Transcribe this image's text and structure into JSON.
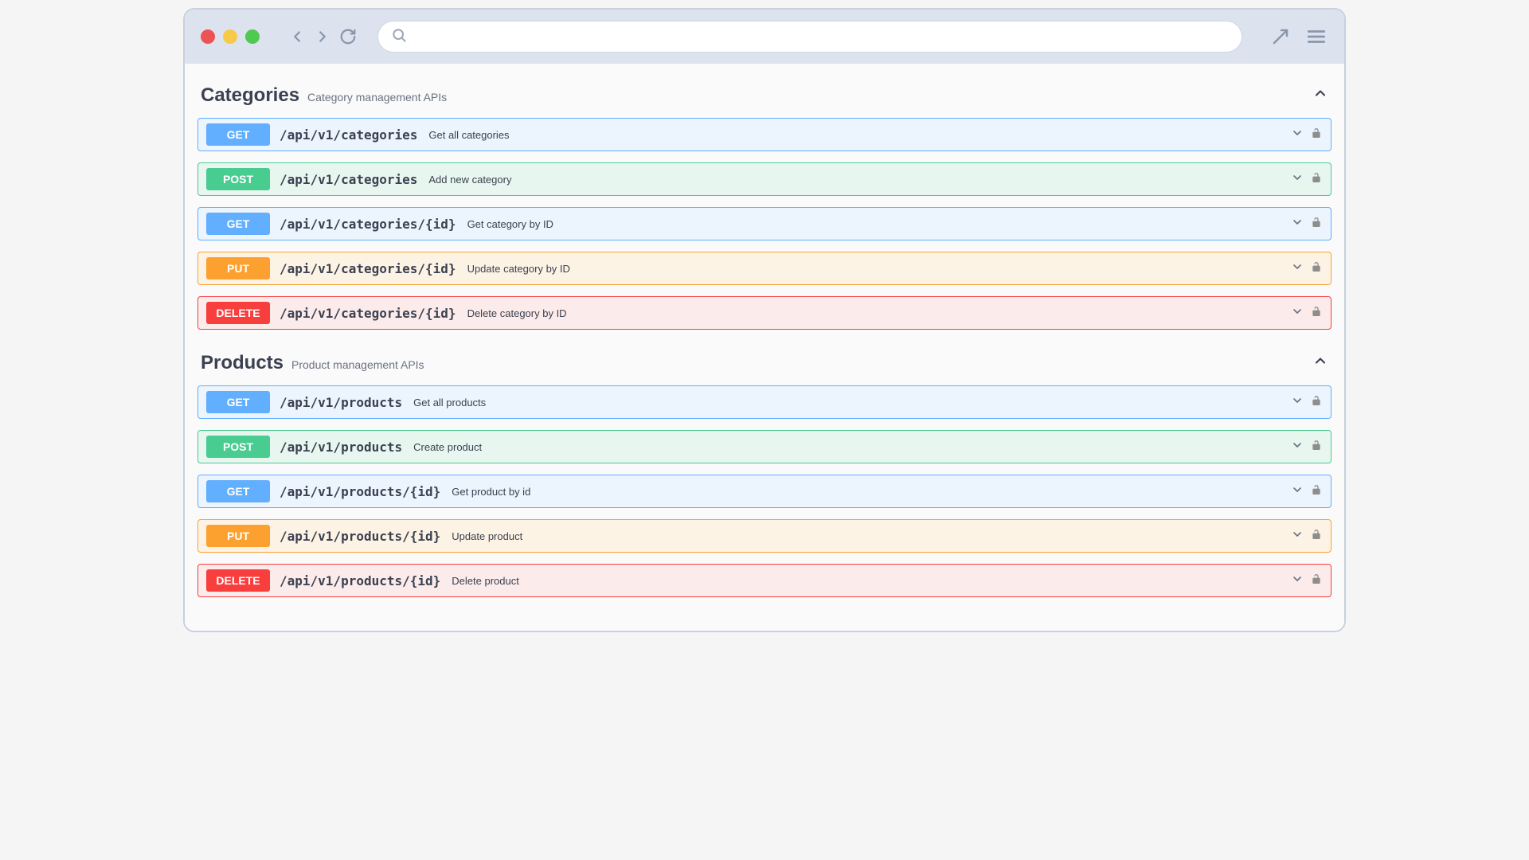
{
  "sections": [
    {
      "name": "Categories",
      "description": "Category management APIs",
      "operations": [
        {
          "method": "GET",
          "path": "/api/v1/categories",
          "summary": "Get all categories"
        },
        {
          "method": "POST",
          "path": "/api/v1/categories",
          "summary": "Add new category"
        },
        {
          "method": "GET",
          "path": "/api/v1/categories/{id}",
          "summary": "Get category by ID"
        },
        {
          "method": "PUT",
          "path": "/api/v1/categories/{id}",
          "summary": "Update category by ID"
        },
        {
          "method": "DELETE",
          "path": "/api/v1/categories/{id}",
          "summary": "Delete category by ID"
        }
      ]
    },
    {
      "name": "Products",
      "description": "Product management APIs",
      "operations": [
        {
          "method": "GET",
          "path": "/api/v1/products",
          "summary": "Get all products"
        },
        {
          "method": "POST",
          "path": "/api/v1/products",
          "summary": "Create product"
        },
        {
          "method": "GET",
          "path": "/api/v1/products/{id}",
          "summary": "Get product by id"
        },
        {
          "method": "PUT",
          "path": "/api/v1/products/{id}",
          "summary": "Update product"
        },
        {
          "method": "DELETE",
          "path": "/api/v1/products/{id}",
          "summary": "Delete product"
        }
      ]
    }
  ]
}
